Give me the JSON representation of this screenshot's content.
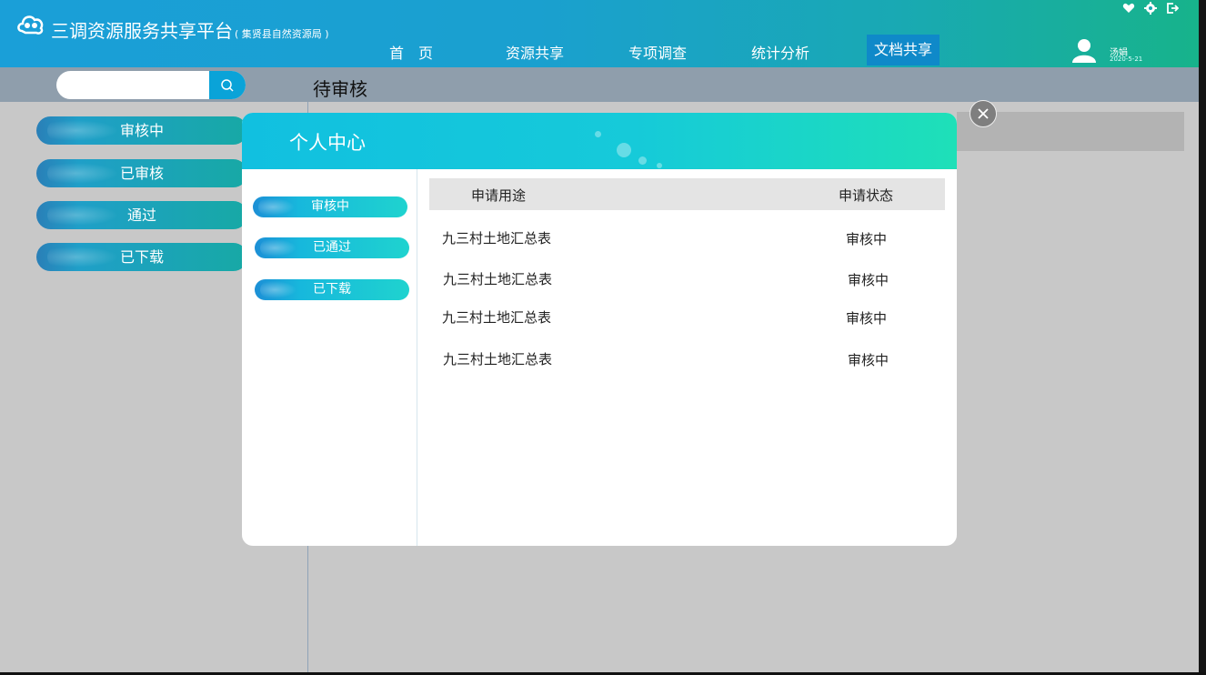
{
  "app": {
    "title": "三调资源服务共享平台",
    "subtitle": "( 集贤县自然资源局 )"
  },
  "nav": {
    "items": [
      {
        "label": "首　页"
      },
      {
        "label": "资源共享"
      },
      {
        "label": "专项调查"
      },
      {
        "label": "统计分析"
      },
      {
        "label": "文档共享"
      }
    ],
    "active": "文档共享"
  },
  "topbar": {
    "icons": [
      "heart-icon",
      "gear-icon",
      "logout-icon"
    ]
  },
  "user": {
    "name": "汤娟",
    "date": "2020-5-21"
  },
  "search": {
    "placeholder": ""
  },
  "page": {
    "heading": "待审核"
  },
  "sidebar": {
    "items": [
      {
        "label": "审核中"
      },
      {
        "label": "已审核"
      },
      {
        "label": "通过"
      },
      {
        "label": "已下载"
      }
    ]
  },
  "modal": {
    "title": "个人中心",
    "tabs": [
      {
        "label": "审核中"
      },
      {
        "label": "已通过"
      },
      {
        "label": "已下载"
      }
    ],
    "table": {
      "columns": [
        "申请用途",
        "申请状态"
      ],
      "rows": [
        {
          "purpose": "九三村土地汇总表",
          "status": "审核中"
        },
        {
          "purpose": "九三村土地汇总表",
          "status": "审核中"
        },
        {
          "purpose": "九三村土地汇总表",
          "status": "审核中"
        },
        {
          "purpose": "九三村土地汇总表",
          "status": "审核中"
        }
      ]
    }
  },
  "colors": {
    "header_start": "#1a9fd8",
    "header_end": "#17b38b",
    "active_nav": "#0f89c9",
    "modal_header_start": "#11c0e0",
    "modal_header_end": "#1ee0b8"
  }
}
